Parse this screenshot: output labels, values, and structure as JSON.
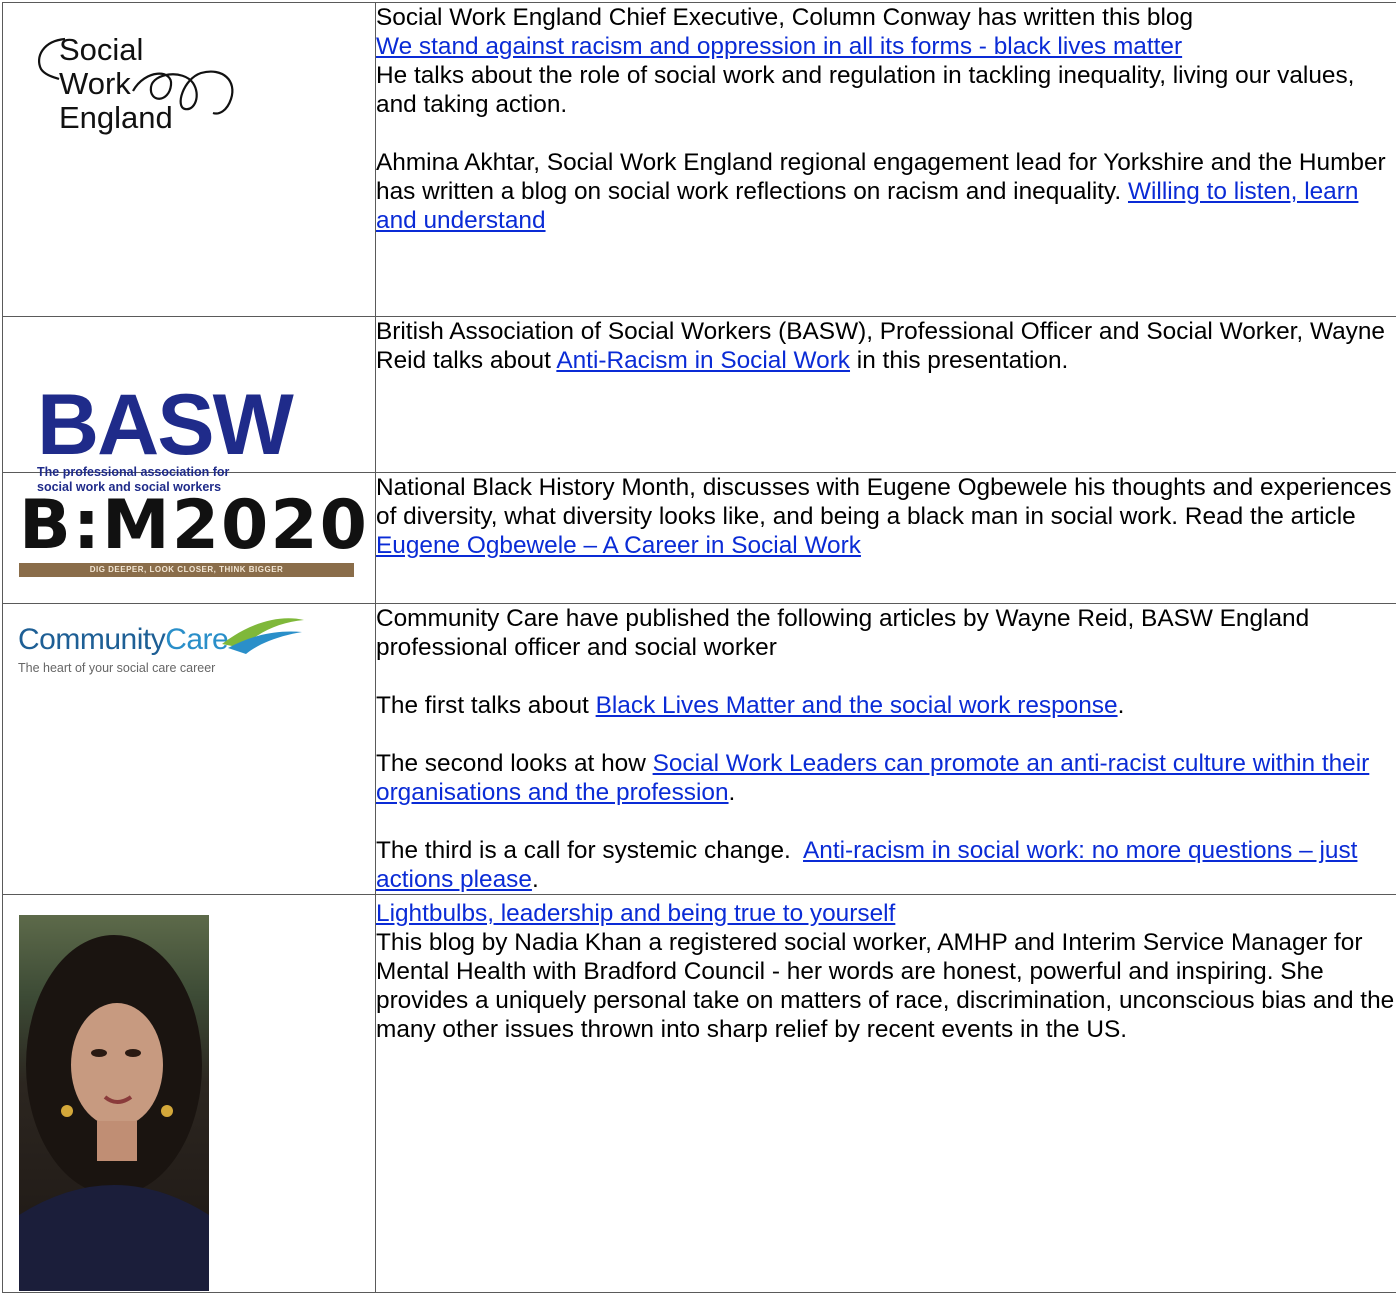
{
  "rows": [
    {
      "logo": {
        "lines": [
          "Social",
          "Work",
          "England"
        ],
        "icon": "loop-curl-icon"
      },
      "p1_text": "Social Work England Chief Executive, Column Conway has written this blog",
      "p1_link": "We stand against racism and oppression in all its forms - black lives matter",
      "p1_after": "He talks about the role of social work and regulation in tackling inequality, living our values, and taking action.",
      "p2_text": "Ahmina Akhtar, Social Work England regional engagement lead for Yorkshire and the Humber has written a blog on social work reflections on racism and inequality.",
      "p2_link": "Willing to listen, learn and understand"
    },
    {
      "logo": {
        "main": "BASW",
        "sub1": "The professional association for",
        "sub2": "social work and social workers"
      },
      "text_before": "British Association of Social Workers (BASW), Professional Officer and Social Worker, Wayne Reid talks about",
      "link": "Anti-Racism in Social Work",
      "text_after": "in this presentation."
    },
    {
      "logo": {
        "main": "B:M2020",
        "tagline": "DIG DEEPER, LOOK CLOSER, THINK BIGGER"
      },
      "text_before": "National Black History Month, discusses with Eugene Ogbewele his thoughts and experiences of diversity, what diversity looks like, and being a black man in social work.  Read the article",
      "link": "Eugene Ogbewele – A Career in Social Work"
    },
    {
      "logo": {
        "main_a": "Community",
        "main_b": "Care",
        "tagline": "The heart of your social care career",
        "icon": "leaf-swoosh-icon"
      },
      "intro": "Community Care have published the following articles by Wayne Reid, BASW England professional officer and social worker",
      "first_text": "The first talks about",
      "first_link": "Black Lives Matter and the social work response",
      "second_text": "The second looks at how",
      "second_link": "Social Work Leaders can promote an anti-racist culture within their organisations and the profession",
      "third_text": "The third is a call for systemic change.",
      "third_link": "Anti-racism in social work: no more questions – just actions please",
      "period": "."
    },
    {
      "photo": "portrait-photo",
      "link": "Lightbulbs, leadership and being true to yourself",
      "text": "This blog by Nadia Khan a registered social worker, AMHP and Interim Service Manager for Mental Health with Bradford Council - her words are honest, powerful and inspiring.  She provides a uniquely personal take on matters of race, discrimination, unconscious bias and the many other issues thrown into sharp relief by recent events in the US."
    }
  ],
  "colors": {
    "link": "#0a2bd6",
    "basw_blue": "#1f2b8a",
    "bhm_bar": "#8a6d4a",
    "cc_blue": "#1e5f95",
    "cc_green": "#7fb83a"
  }
}
